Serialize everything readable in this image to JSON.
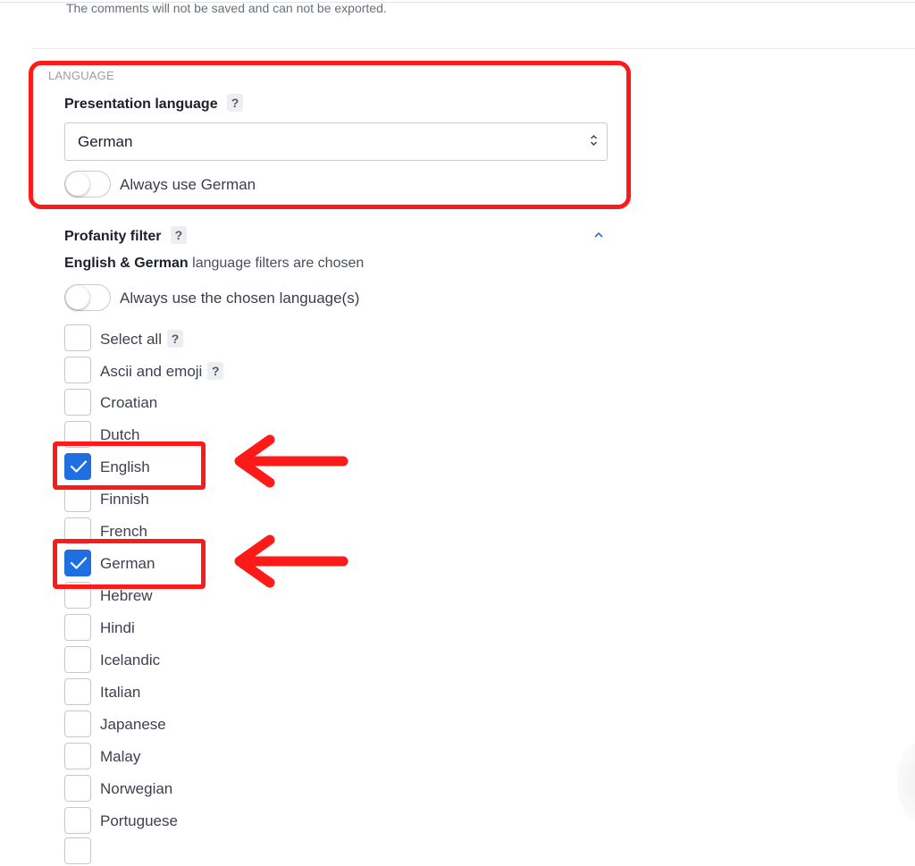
{
  "notice": "The comments will not be saved and can not be exported.",
  "language_section": {
    "heading": "LANGUAGE",
    "presentation_label": "Presentation language",
    "help_glyph": "?",
    "select_value": "German",
    "always_use_label": "Always use German",
    "always_use_on": false
  },
  "profanity": {
    "label": "Profanity filter",
    "help_glyph": "?",
    "note_lang1": "English",
    "note_amp": " & ",
    "note_lang2": "German",
    "note_rest": " language filters are chosen",
    "always_use_label": "Always use the chosen language(s)",
    "always_use_on": false,
    "options": [
      {
        "label": "Select all",
        "checked": false,
        "help": "?"
      },
      {
        "label": "Ascii and emoji",
        "checked": false,
        "help": "?"
      },
      {
        "label": "Croatian",
        "checked": false
      },
      {
        "label": "Dutch",
        "checked": false
      },
      {
        "label": "English",
        "checked": true
      },
      {
        "label": "Finnish",
        "checked": false
      },
      {
        "label": "French",
        "checked": false
      },
      {
        "label": "German",
        "checked": true
      },
      {
        "label": "Hebrew",
        "checked": false
      },
      {
        "label": "Hindi",
        "checked": false
      },
      {
        "label": "Icelandic",
        "checked": false
      },
      {
        "label": "Italian",
        "checked": false
      },
      {
        "label": "Japanese",
        "checked": false
      },
      {
        "label": "Malay",
        "checked": false
      },
      {
        "label": "Norwegian",
        "checked": false
      },
      {
        "label": "Portuguese",
        "checked": false
      }
    ]
  },
  "icons": {
    "select_arrow": "up-down-chevron-icon",
    "collapse": "chevron-up-icon",
    "checkmark": "checkmark-icon",
    "annotation_arrow": "left-arrow-icon"
  },
  "colors": {
    "accent": "#1f6fe0",
    "annotation": "#ff1a1a"
  }
}
